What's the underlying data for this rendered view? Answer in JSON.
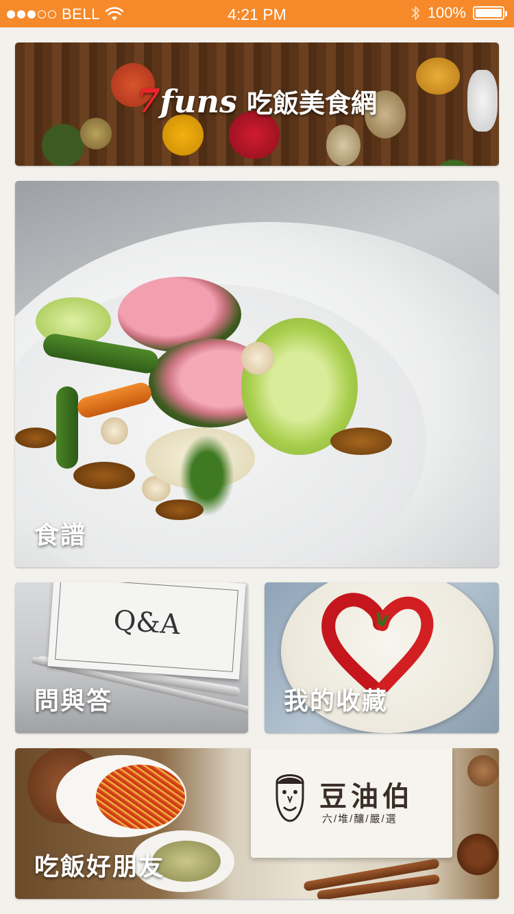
{
  "status_bar": {
    "carrier": "BELL",
    "signal_bars_filled": 3,
    "signal_bars_total": 5,
    "time": "4:21 PM",
    "battery": "100%"
  },
  "banner": {
    "logo_number": "7",
    "logo_word": "funs",
    "site_name": "吃飯美食網"
  },
  "tiles": {
    "recipes": "食譜",
    "qa": "問與答",
    "qa_card_text": "Q&A",
    "favorites": "我的收藏",
    "friends": "吃飯好朋友",
    "friends_brand": "豆油伯",
    "friends_brand_sub": "六/堆/釀/嚴/選"
  },
  "colors": {
    "status_bar": "#f6892a",
    "background": "#f3f1ec",
    "logo_accent": "#e8262a"
  }
}
